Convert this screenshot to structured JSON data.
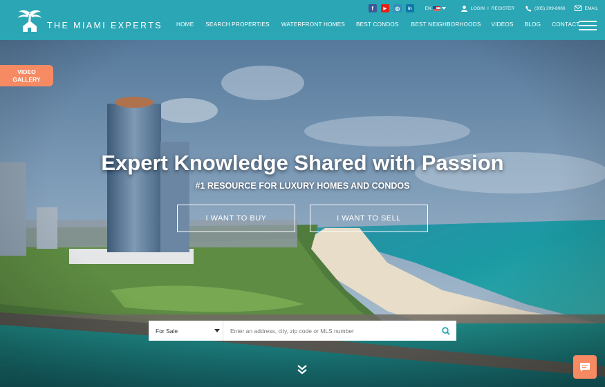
{
  "brand": {
    "name": "THE MIAMI EXPERTS"
  },
  "topbar": {
    "social": [
      {
        "icon": "facebook-icon",
        "glyph": "f",
        "color": "#3b5998"
      },
      {
        "icon": "youtube-icon",
        "glyph": "▶",
        "color": "#e62117"
      },
      {
        "icon": "instagram-icon",
        "glyph": "◎",
        "color": "#2f8fb8"
      },
      {
        "icon": "linkedin-icon",
        "glyph": "in",
        "color": "#0e76a8"
      }
    ],
    "language": "EN",
    "login": "LOGIN",
    "separator": "I",
    "register": "REGISTER",
    "phone": "(305) 209-8066",
    "email": "EMAIL"
  },
  "nav": {
    "items": [
      "HOME",
      "SEARCH PROPERTIES",
      "WATERFRONT HOMES",
      "BEST CONDOS",
      "BEST NEIGHBORHOODS",
      "VIDEOS",
      "BLOG",
      "CONTACT"
    ]
  },
  "video_gallery": {
    "line1": "VIDEO",
    "line2": "GALLERY"
  },
  "hero": {
    "headline": "Expert Knowledge Shared with Passion",
    "subheadline": "#1 RESOURCE FOR LUXURY HOMES AND CONDOS",
    "buy_label": "I WANT TO BUY",
    "sell_label": "I WANT TO SELL"
  },
  "search": {
    "type_value": "For Sale",
    "placeholder": "Enter an address, city, zip code or MLS number"
  },
  "colors": {
    "header": "#2aa6b5",
    "accent": "#f68a63"
  }
}
